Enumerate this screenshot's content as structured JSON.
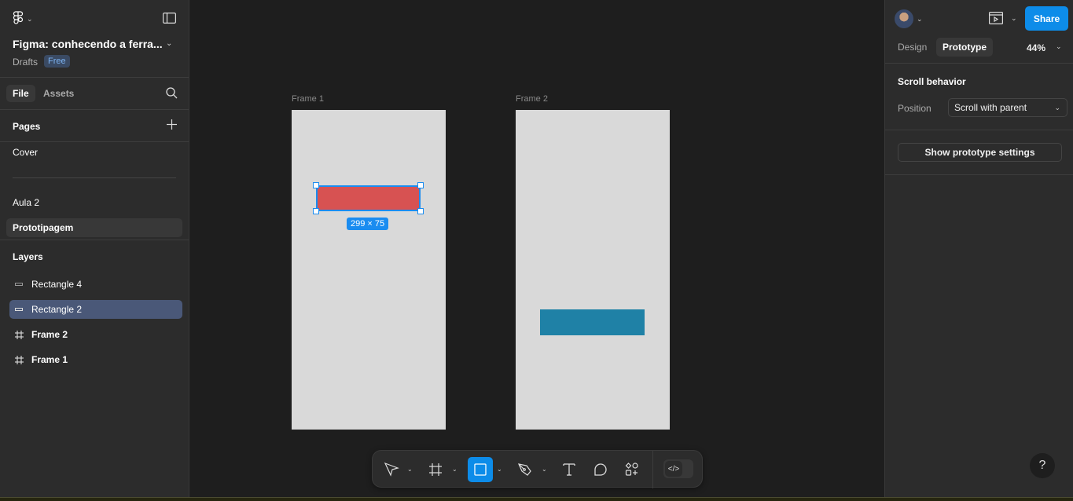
{
  "header": {
    "file_title": "Figma: conhecendo a ferra...",
    "location": "Drafts",
    "plan_badge": "Free"
  },
  "left_tabs": [
    {
      "label": "File",
      "active": true
    },
    {
      "label": "Assets",
      "active": false
    }
  ],
  "pages": {
    "title": "Pages",
    "items": [
      {
        "label": "Cover",
        "selected": false
      },
      {
        "label": "Aula 2",
        "selected": false
      },
      {
        "label": "Prototipagem",
        "selected": true
      }
    ]
  },
  "layers": {
    "title": "Layers",
    "items": [
      {
        "label": "Rectangle 4",
        "type": "rectangle",
        "selected": false
      },
      {
        "label": "Rectangle 2",
        "type": "rectangle",
        "selected": true
      },
      {
        "label": "Frame 2",
        "type": "frame",
        "selected": false
      },
      {
        "label": "Frame 1",
        "type": "frame",
        "selected": false
      }
    ]
  },
  "canvas": {
    "frames": [
      {
        "label": "Frame 1"
      },
      {
        "label": "Frame 2"
      }
    ],
    "selection_size": "299 × 75",
    "colors": {
      "frame_fill": "#d9d9d9",
      "red_rect": "#d75252",
      "blue_rect": "#1f81a6",
      "selection": "#1a8cf0"
    }
  },
  "toolbar": {
    "tools": [
      "move-tool",
      "frame-tool",
      "rectangle-tool",
      "pen-tool",
      "text-tool",
      "comment-tool",
      "actions-tool"
    ],
    "active_tool": "rectangle-tool",
    "dev_mode_label": "</>"
  },
  "right_panel": {
    "share_label": "Share",
    "tabs": [
      {
        "label": "Design",
        "active": false
      },
      {
        "label": "Prototype",
        "active": true
      }
    ],
    "zoom": "44%",
    "scroll_behavior": {
      "title": "Scroll behavior",
      "position_label": "Position",
      "position_value": "Scroll with parent"
    },
    "show_settings_label": "Show prototype settings",
    "help_label": "?"
  }
}
